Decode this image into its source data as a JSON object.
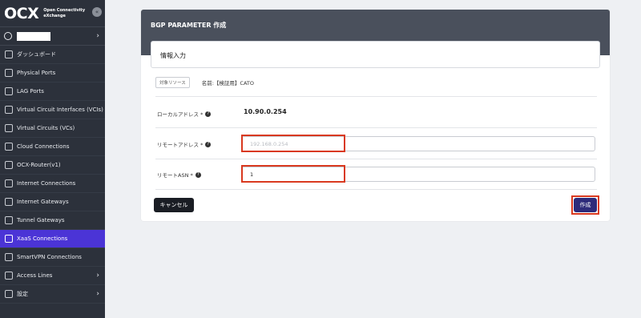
{
  "sidebar": {
    "logo_mark": "OCX",
    "logo_text_line1": "Open Connectivity",
    "logo_text_line2": "eXchange",
    "collapse_icon": "«",
    "items": [
      {
        "label": "ダッシュボード"
      },
      {
        "label": "Physical Ports"
      },
      {
        "label": "LAG Ports"
      },
      {
        "label": "Virtual Circuit Interfaces (VCIs)"
      },
      {
        "label": "Virtual Circuits (VCs)"
      },
      {
        "label": "Cloud Connections"
      },
      {
        "label": "OCX-Router(v1)"
      },
      {
        "label": "Internet Connections"
      },
      {
        "label": "Internet Gateways"
      },
      {
        "label": "Tunnel Gateways"
      },
      {
        "label": "XaaS Connections",
        "active": true
      },
      {
        "label": "SmartVPN Connections"
      },
      {
        "label": "Access Lines"
      },
      {
        "label": "設定"
      }
    ],
    "colors": {
      "bg": "#2c313b",
      "active": "#4b34d6"
    }
  },
  "card": {
    "title": "BGP PARAMETER 作成",
    "section_title": "情報入力",
    "target_tag": "対象リソース",
    "name_label": "名前:【検証用】CATO",
    "fields": {
      "local_label": "ローカルアドレス *",
      "local_value": "10.90.0.254",
      "remote_label": "リモートアドレス *",
      "remote_placeholder": "192.168.0.254",
      "asn_label": "リモートASN *",
      "asn_value": "1"
    },
    "cancel_label": "キャンセル",
    "create_label": "作成",
    "highlight_color": "#d9391f"
  }
}
